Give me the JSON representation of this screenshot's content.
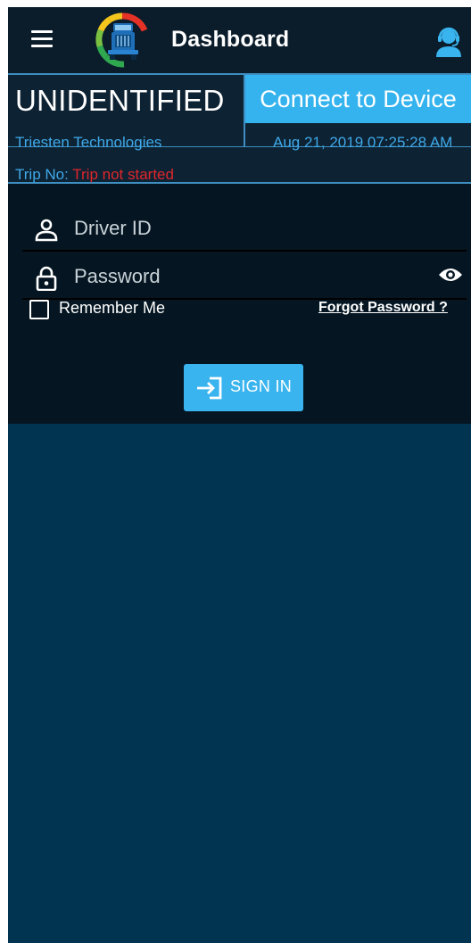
{
  "appbar": {
    "title": "Dashboard",
    "menu_icon": "hamburger-menu-icon",
    "logo_icon": "truck-gauge-logo",
    "support_icon": "headset-user-icon"
  },
  "status": {
    "unit_name": "UNIDENTIFIED",
    "connect_label": "Connect to Device",
    "company": "Triesten Technologies",
    "datetime": "Aug 21, 2019 07:25:28 AM",
    "trip_label": "Trip No: ",
    "trip_value": "Trip not started"
  },
  "login": {
    "driver_id_placeholder": "Driver ID",
    "password_placeholder": "Password",
    "remember_label": "Remember Me",
    "remember_checked": false,
    "forgot_label": "Forgot Password ?",
    "signin_label": "SIGN IN",
    "driver_icon": "person-outline-icon",
    "password_icon": "lock-outline-icon",
    "visibility_icon": "eye-icon",
    "signin_icon": "sign-in-arrow-icon"
  },
  "colors": {
    "background": "#003451",
    "appbar": "#0b1c2a",
    "accent": "#34b3ee",
    "link_blue": "#3fa9e8",
    "error_red": "#e0262b",
    "login_panel": "#051622"
  }
}
